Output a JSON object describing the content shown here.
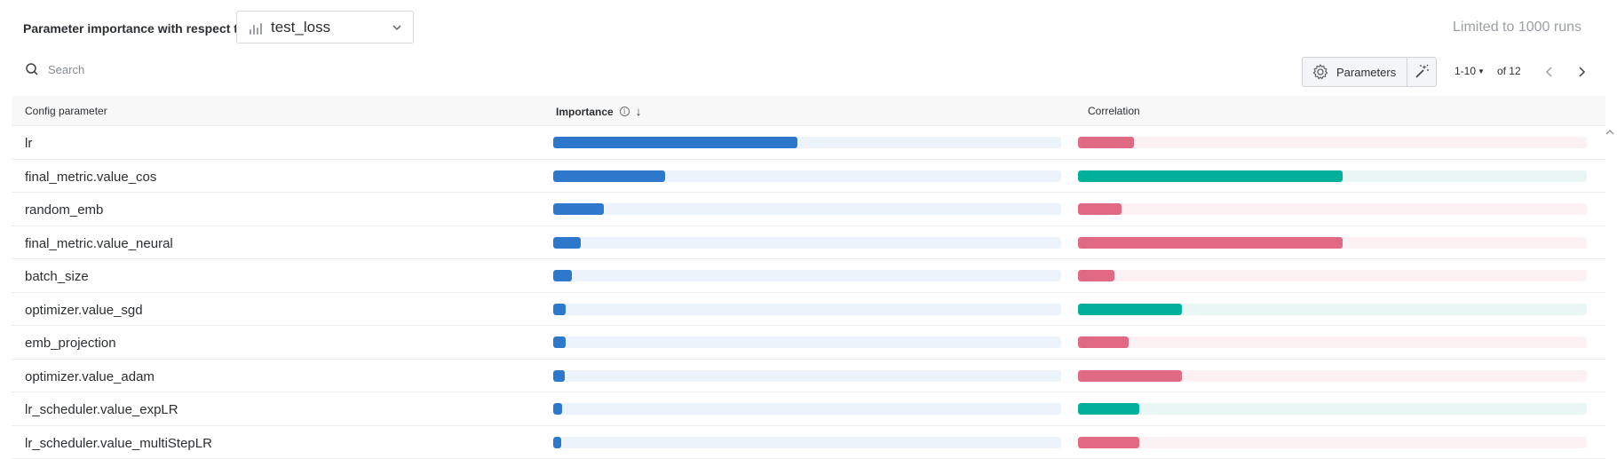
{
  "header": {
    "title": "Parameter importance with respect to",
    "metric_value": "test_loss",
    "limit_text": "Limited to 1000 runs"
  },
  "toolbar": {
    "search_placeholder": "Search",
    "parameters_label": "Parameters",
    "page_range": "1-10",
    "page_total": "of 12"
  },
  "table": {
    "columns": [
      "Config parameter",
      "Importance",
      "Correlation"
    ],
    "rows": [
      {
        "name": "lr",
        "importance": 0.48,
        "correlation": -0.11
      },
      {
        "name": "final_metric.value_cos",
        "importance": 0.22,
        "correlation": 0.52
      },
      {
        "name": "random_emb",
        "importance": 0.1,
        "correlation": -0.085
      },
      {
        "name": "final_metric.value_neural",
        "importance": 0.055,
        "correlation": -0.52
      },
      {
        "name": "batch_size",
        "importance": 0.037,
        "correlation": -0.072
      },
      {
        "name": "optimizer.value_sgd",
        "importance": 0.025,
        "correlation": 0.205
      },
      {
        "name": "emb_projection",
        "importance": 0.024,
        "correlation": -0.1
      },
      {
        "name": "optimizer.value_adam",
        "importance": 0.022,
        "correlation": -0.205
      },
      {
        "name": "lr_scheduler.value_expLR",
        "importance": 0.017,
        "correlation": 0.12
      },
      {
        "name": "lr_scheduler.value_multiStepLR",
        "importance": 0.016,
        "correlation": -0.12
      }
    ]
  },
  "colors": {
    "importance": "#2e78cc",
    "positive_correlation": "#00b09b",
    "negative_correlation": "#e06a83"
  },
  "icons": {
    "metric": "bar-chart-icon",
    "dropdown": "chevron-down-icon",
    "search": "search-icon",
    "parameters": "gear-icon",
    "magic": "magic-wand-icon",
    "info": "info-icon",
    "sort": "arrow-down-icon",
    "prev": "chevron-left-icon",
    "next": "chevron-right-icon"
  }
}
